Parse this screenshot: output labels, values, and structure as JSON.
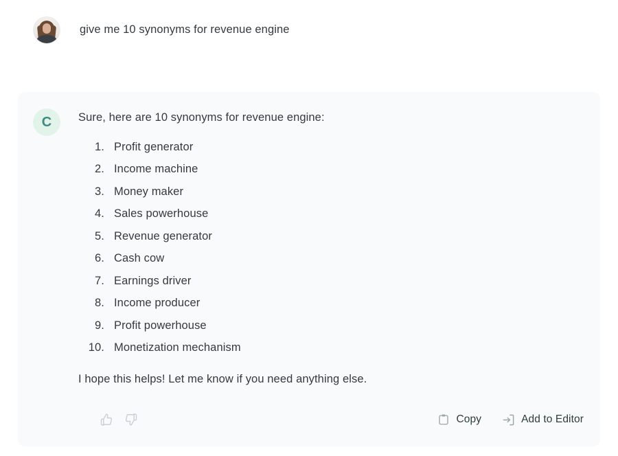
{
  "conversation": {
    "user_turn": {
      "avatar": "user-profile-photo",
      "message": "give me 10 synonyms for revenue engine"
    },
    "assistant_turn": {
      "avatar_letter": "C",
      "avatar_bg_color": "#e2f3e9",
      "avatar_text_color": "#3f8b83",
      "intro": "Sure, here are 10 synonyms for revenue engine:",
      "list": [
        {
          "number": "1.",
          "text": "Profit generator"
        },
        {
          "number": "2.",
          "text": "Income machine"
        },
        {
          "number": "3.",
          "text": "Money maker"
        },
        {
          "number": "4.",
          "text": "Sales powerhouse"
        },
        {
          "number": "5.",
          "text": "Revenue generator"
        },
        {
          "number": "6.",
          "text": "Cash cow"
        },
        {
          "number": "7.",
          "text": "Earnings driver"
        },
        {
          "number": "8.",
          "text": "Income producer"
        },
        {
          "number": "9.",
          "text": "Profit powerhouse"
        },
        {
          "number": "10.",
          "text": "Monetization mechanism"
        }
      ],
      "outro": "I hope this helps! Let me know if you need anything else.",
      "footer": {
        "thumbs_up_icon": "thumbs-up-icon",
        "thumbs_down_icon": "thumbs-down-icon",
        "copy_icon": "clipboard-icon",
        "copy_label": "Copy",
        "add_to_editor_icon": "arrow-into-box-icon",
        "add_to_editor_label": "Add to Editor"
      }
    }
  },
  "colors": {
    "page_background": "#ffffff",
    "card_background": "#f8fafb",
    "body_text": "#343a40",
    "action_text": "#2f3d3a",
    "muted_icon": "#c9d1d4"
  }
}
